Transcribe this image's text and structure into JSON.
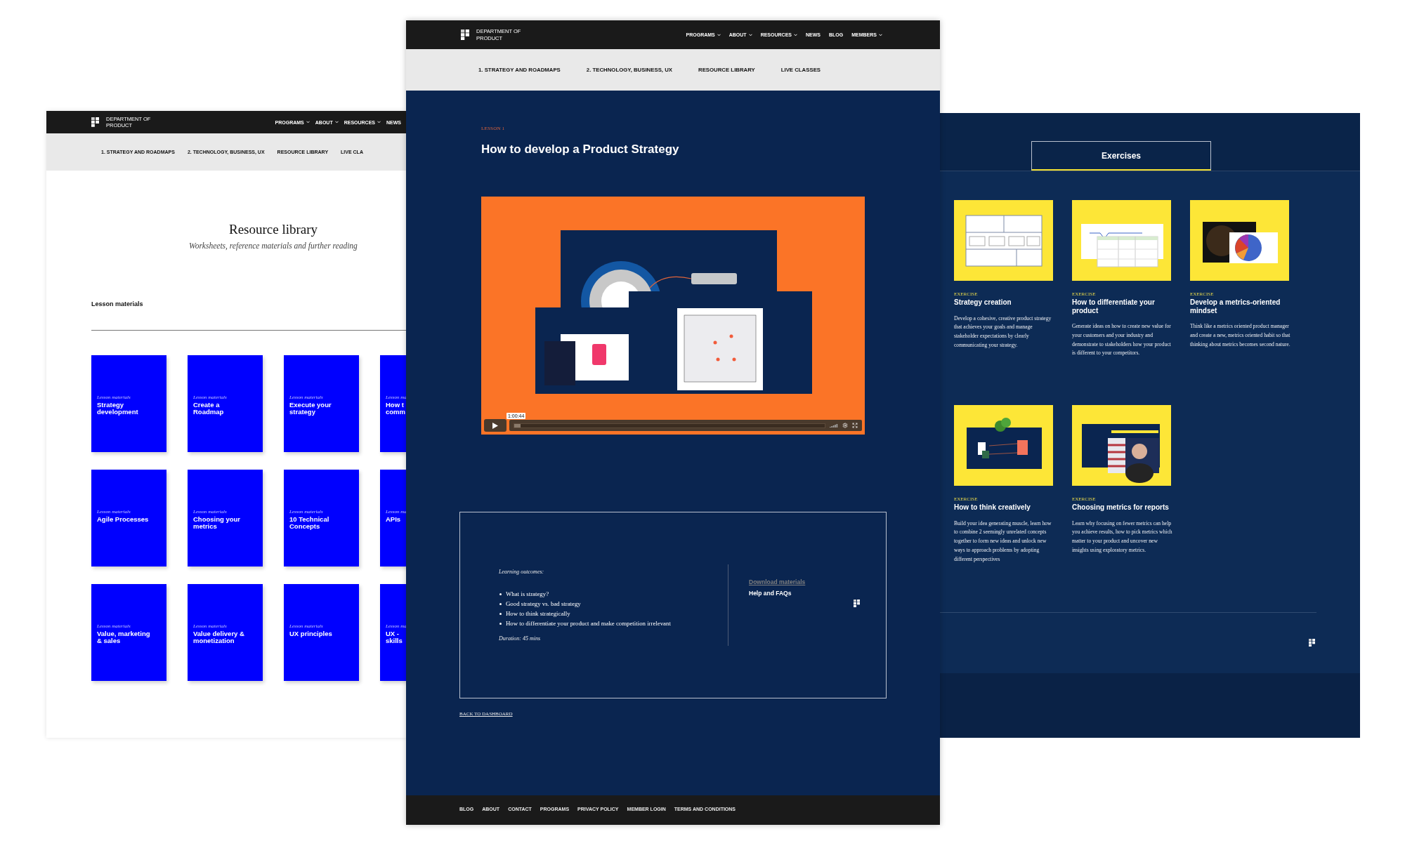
{
  "resource_page": {
    "brand": "DEPARTMENT OF\nPRODUCT",
    "nav": [
      {
        "label": "PROGRAMS",
        "has_menu": true
      },
      {
        "label": "ABOUT",
        "has_menu": true
      },
      {
        "label": "RESOURCES",
        "has_menu": true
      },
      {
        "label": "NEWS",
        "has_menu": false
      }
    ],
    "subnav": [
      "1. STRATEGY AND ROADMAPS",
      "2. TECHNOLOGY, BUSINESS, UX",
      "RESOURCE LIBRARY",
      "LIVE CLA"
    ],
    "title": "Resource library",
    "subtitle": "Worksheets, reference materials and further reading",
    "section_title": "Lesson materials",
    "tiles": [
      {
        "label": "Lesson materials",
        "title": "Strategy\ndevelopment"
      },
      {
        "label": "Lesson materials",
        "title": "Create a\nRoadmap"
      },
      {
        "label": "Lesson materials",
        "title": "Execute your\nstrategy"
      },
      {
        "label": "Lesson ma",
        "title": "How t\ncomm"
      },
      {
        "label": "Lesson materials",
        "title": "Agile Processes"
      },
      {
        "label": "Lesson materials",
        "title": "Choosing your\nmetrics"
      },
      {
        "label": "Lesson materials",
        "title": "10 Technical\nConcepts"
      },
      {
        "label": "Lesson ma",
        "title": "APIs"
      },
      {
        "label": "Lesson materials",
        "title": "Value, marketing\n& sales"
      },
      {
        "label": "Lesson materials",
        "title": "Value delivery &\nmonetization"
      },
      {
        "label": "Lesson materials",
        "title": "UX principles"
      },
      {
        "label": "Lesson ma",
        "title": "UX -\nskills"
      }
    ]
  },
  "lesson_page": {
    "brand": "DEPARTMENT OF\nPRODUCT",
    "nav": [
      {
        "label": "PROGRAMS",
        "has_menu": true
      },
      {
        "label": "ABOUT",
        "has_menu": true
      },
      {
        "label": "RESOURCES",
        "has_menu": true
      },
      {
        "label": "NEWS",
        "has_menu": false
      },
      {
        "label": "BLOG",
        "has_menu": false
      },
      {
        "label": "MEMBERS",
        "has_menu": true
      }
    ],
    "subnav": [
      "1. STRATEGY AND ROADMAPS",
      "2. TECHNOLOGY, BUSINESS, UX",
      "RESOURCE LIBRARY",
      "LIVE CLASSES"
    ],
    "eyebrow": "LESSON 1",
    "title": "How to develop a Product Strategy",
    "video": {
      "time": "1:00:44",
      "level": 0.02
    },
    "outcomes": {
      "heading": "Learning outcomes:",
      "items": [
        "What is strategy?",
        "Good strategy vs. bad strategy",
        "How to think strategically",
        "How to differentiate your product and make competition irrelevant"
      ],
      "duration": "Duration: 45 mins"
    },
    "links": [
      {
        "label": "Download materials",
        "kind": "download"
      },
      {
        "label": "Help and FAQs",
        "kind": "help"
      }
    ],
    "back_link": "BACK TO DASHBOARD",
    "footer_links": [
      "BLOG",
      "ABOUT",
      "CONTACT",
      "PROGRAMS",
      "PRIVACY POLICY",
      "MEMBER LOGIN",
      "TERMS AND CONDITIONS"
    ]
  },
  "exercises_page": {
    "tab": "Exercises",
    "cards": [
      {
        "eyebrow": "EXERCISE",
        "title": "Strategy creation",
        "description": "Develop a cohesive, creative product strategy that achieves your goals and manage stakeholder expectations by clearly communicating your strategy."
      },
      {
        "eyebrow": "EXERCISE",
        "title": "How to differentiate your product",
        "description": "Generate ideas on how to create new value for your customers and your industry and demonstrate to stakeholders how your product is different to your competitors."
      },
      {
        "eyebrow": "EXERCISE",
        "title": "Develop a metrics-oriented mindset",
        "description": "Think like a metrics oriented product manager and create a new, metrics oriented habit so that thinking about metrics becomes second nature."
      },
      {
        "eyebrow": "EXERCISE",
        "title": "How to think creatively",
        "description": "Build your idea generating muscle, learn how to combine 2 seemingly unrelated concepts together to form new ideas and unlock new ways to approach problems by adopting different perspectives"
      },
      {
        "eyebrow": "EXERCISE",
        "title": "Choosing metrics for reports",
        "description": "Learn why focusing on fewer metrics can help you achieve results, how to pick metrics which matter to your product and uncover new insights using exploratory metrics."
      }
    ]
  }
}
